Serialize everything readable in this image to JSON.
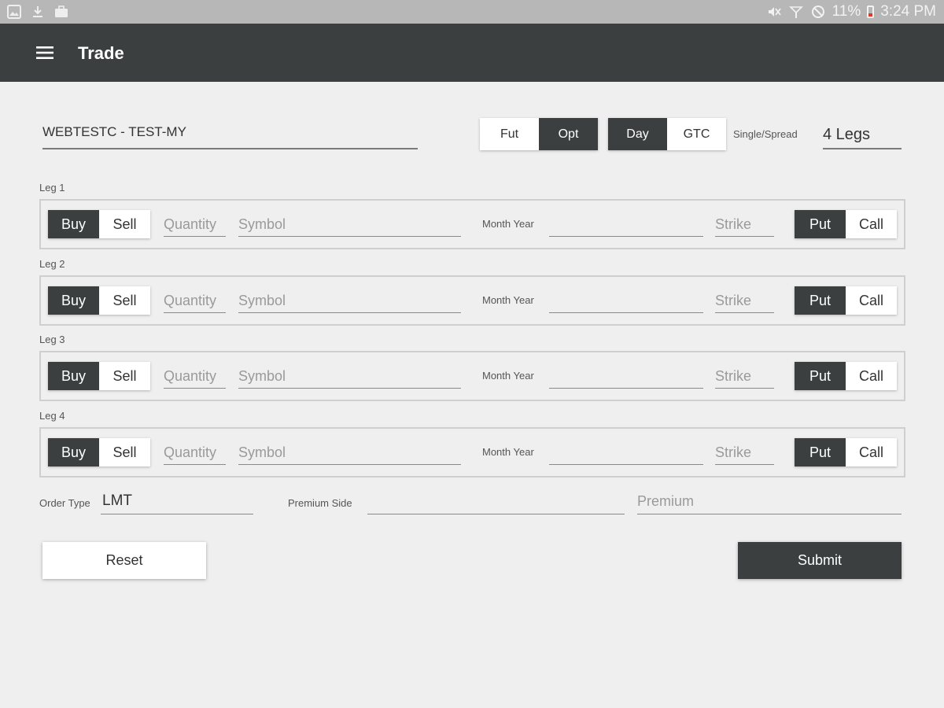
{
  "status_bar": {
    "battery": "11%",
    "time": "3:24 PM"
  },
  "app_bar": {
    "title": "Trade"
  },
  "account": {
    "value": "WEBTESTC - TEST-MY"
  },
  "product_toggle": {
    "options": [
      "Fut",
      "Opt"
    ],
    "selected": "Opt"
  },
  "duration_toggle": {
    "options": [
      "Day",
      "GTC"
    ],
    "selected": "Day"
  },
  "single_spread": {
    "label": "Single/Spread",
    "value": "4 Legs"
  },
  "legs": [
    {
      "label": "Leg 1",
      "side_options": [
        "Buy",
        "Sell"
      ],
      "side_selected": "Buy",
      "quantity_placeholder": "Quantity",
      "symbol_placeholder": "Symbol",
      "month_year_label": "Month Year",
      "strike_placeholder": "Strike",
      "type_options": [
        "Put",
        "Call"
      ],
      "type_selected": "Put"
    },
    {
      "label": "Leg 2",
      "side_options": [
        "Buy",
        "Sell"
      ],
      "side_selected": "Buy",
      "quantity_placeholder": "Quantity",
      "symbol_placeholder": "Symbol",
      "month_year_label": "Month Year",
      "strike_placeholder": "Strike",
      "type_options": [
        "Put",
        "Call"
      ],
      "type_selected": "Put"
    },
    {
      "label": "Leg 3",
      "side_options": [
        "Buy",
        "Sell"
      ],
      "side_selected": "Buy",
      "quantity_placeholder": "Quantity",
      "symbol_placeholder": "Symbol",
      "month_year_label": "Month Year",
      "strike_placeholder": "Strike",
      "type_options": [
        "Put",
        "Call"
      ],
      "type_selected": "Put"
    },
    {
      "label": "Leg 4",
      "side_options": [
        "Buy",
        "Sell"
      ],
      "side_selected": "Buy",
      "quantity_placeholder": "Quantity",
      "symbol_placeholder": "Symbol",
      "month_year_label": "Month Year",
      "strike_placeholder": "Strike",
      "type_options": [
        "Put",
        "Call"
      ],
      "type_selected": "Put"
    }
  ],
  "order": {
    "order_type_label": "Order Type",
    "order_type_value": "LMT",
    "premium_side_label": "Premium Side",
    "premium_placeholder": "Premium"
  },
  "actions": {
    "reset_label": "Reset",
    "submit_label": "Submit"
  },
  "colors": {
    "appbar": "#3b3f40",
    "statusbar": "#b7b7b7",
    "background": "#efefef",
    "selected": "#3b3f40"
  }
}
